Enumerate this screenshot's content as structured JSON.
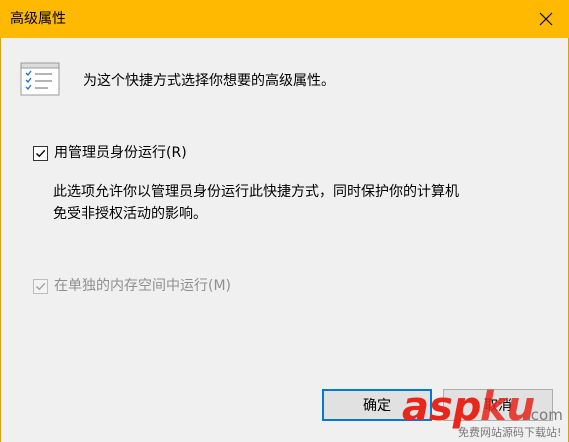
{
  "window": {
    "title": "高级属性",
    "close_icon": "close-icon"
  },
  "header": {
    "icon": "properties-list-icon",
    "text": "为这个快捷方式选择你想要的高级属性。"
  },
  "options": {
    "run_as_admin": {
      "label": "用管理员身份运行(R)",
      "checked": true,
      "enabled": true
    },
    "description_line1": "此选项允许你以管理员身份运行此快捷方式，同时保护你的计算机",
    "description_line2": "免受非授权活动的影响。",
    "separate_memory": {
      "label": "在单独的内存空间中运行(M)",
      "checked": true,
      "enabled": false
    }
  },
  "buttons": {
    "ok_label": "确定",
    "cancel_label": "取消"
  },
  "watermark": {
    "logo_text": "aspku",
    "domain": ".com",
    "tagline": "免费网站源码下载站!"
  },
  "colors": {
    "titlebar": "#ffb900",
    "accent": "#0078d7",
    "watermark_red": "#e8261b"
  }
}
